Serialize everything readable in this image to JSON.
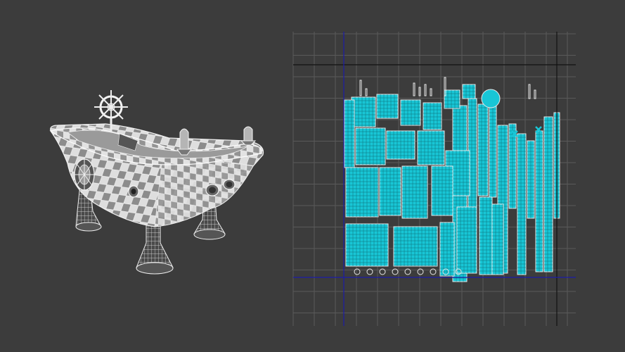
{
  "theme": {
    "background": "#3c3c3c",
    "uv_grid": "#5a5a5a",
    "uv_axis": "#1c1ca8",
    "uv_border": "#111111",
    "uv_shell_fill": "#18c6d6",
    "uv_shell_edge": "#e8e8e8",
    "checker_light": "#dedede",
    "checker_dark": "#8c8c8c",
    "wire": "#f2f2f2"
  },
  "left_viewport": {
    "object": "bathtub-model",
    "shading": "checker-texture-with-wireframe",
    "parts": [
      "tub-body",
      "ship-wheel-ornament",
      "left-rocket-ornament",
      "right-rocket-ornament",
      "porthole-front-left",
      "porthole-front-right",
      "side-wheel-emblem",
      "leg-front",
      "leg-back-left",
      "leg-back-right"
    ]
  },
  "right_viewport": {
    "editor": "uv-editor",
    "content": "uv-shells-layout",
    "icons": [
      "x-marker-icon",
      "x-marker-icon"
    ]
  }
}
